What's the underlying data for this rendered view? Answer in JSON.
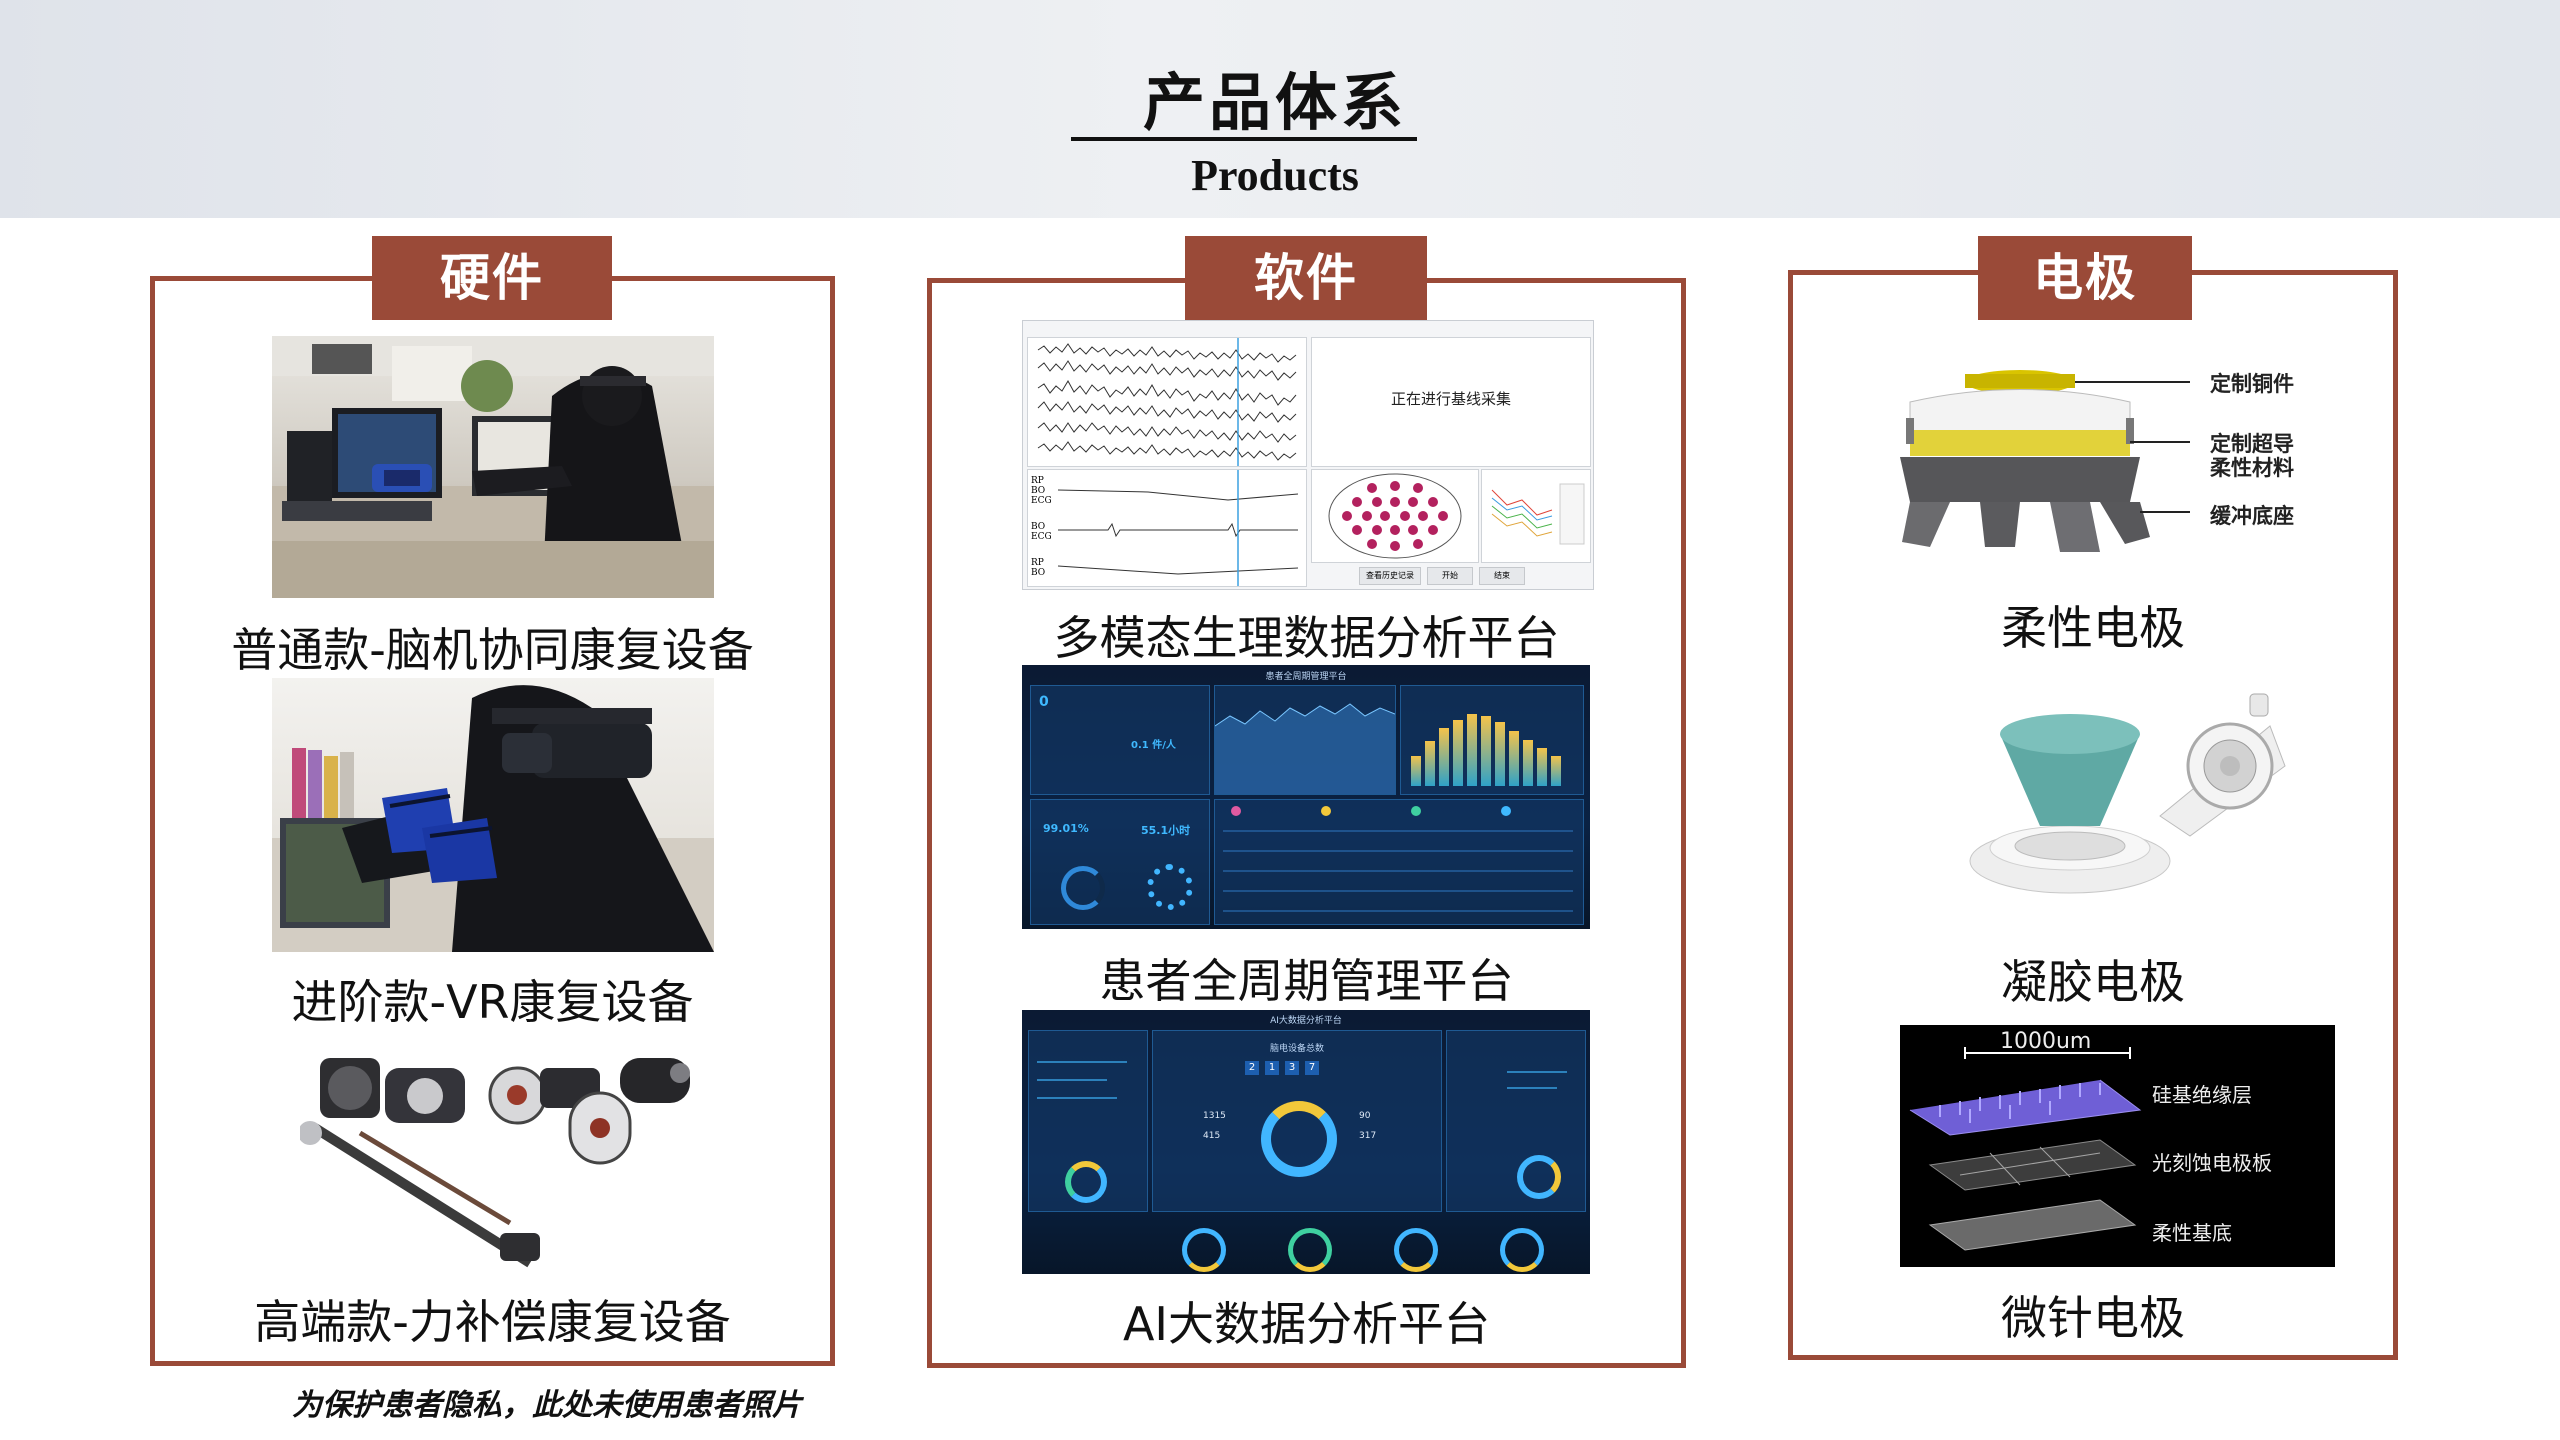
{
  "header": {
    "title_cn": "产品体系",
    "title_en": "Products"
  },
  "hardware": {
    "tag": "硬件",
    "items": [
      {
        "caption": "普通款-脑机协同康复设备"
      },
      {
        "caption": "进阶款-VR康复设备"
      },
      {
        "caption": "高端款-力补偿康复设备"
      }
    ]
  },
  "software": {
    "tag": "软件",
    "items": [
      {
        "caption": "多模态生理数据分析平台"
      },
      {
        "caption": "患者全周期管理平台"
      },
      {
        "caption": "AI大数据分析平台"
      }
    ],
    "screen1": {
      "status_text": "正在进行基线采集",
      "channel_labels": [
        "RP",
        "BO",
        "ECG",
        "BO",
        "ECG",
        "RP",
        "BO"
      ],
      "button_labels": [
        "查看历史记录",
        "开始",
        "结束"
      ]
    },
    "screen2": {
      "title": "患者全周期管理平台",
      "stat_a": "99.01%",
      "stat_b": "55.1小时",
      "stat_c": "0.1 件/人",
      "stat_d": "0"
    },
    "screen3": {
      "title": "AI大数据分析平台",
      "center_title": "脑电设备总数",
      "digits": [
        "2",
        "1",
        "3",
        "7"
      ],
      "stat_left_1": "1315",
      "stat_left_2": "415",
      "stat_right_1": "90",
      "stat_right_2": "317"
    }
  },
  "electrode": {
    "tag": "电极",
    "items": [
      {
        "caption": "柔性电极"
      },
      {
        "caption": "凝胶电极"
      },
      {
        "caption": "微针电极"
      }
    ],
    "flex_labels": [
      "定制铜件",
      "定制超导\n柔性材料",
      "缓冲底座"
    ],
    "micro_scale": "1000um",
    "micro_labels": [
      "硅基绝缘层",
      "光刻蚀电极板",
      "柔性基底"
    ]
  },
  "footnote": "为保护患者隐私，此处未使用患者照片",
  "colors": {
    "accent": "#9a4a38",
    "dark_screen": "#0b1a33",
    "electrode_gold": "#d9c400",
    "gel_teal": "#5fa9a4"
  }
}
